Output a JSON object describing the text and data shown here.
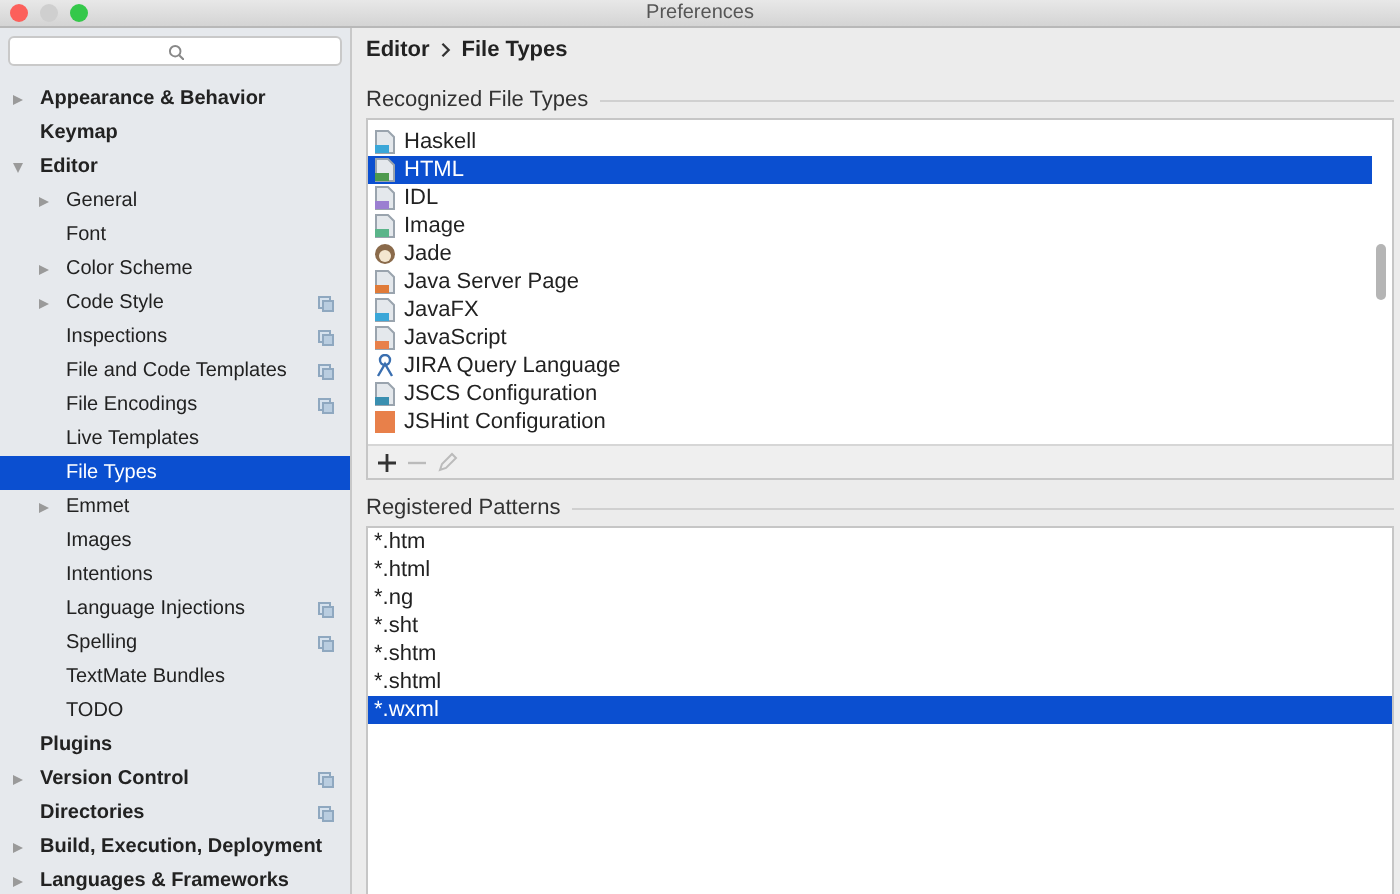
{
  "window": {
    "title": "Preferences"
  },
  "sidebar": {
    "items": [
      {
        "label": "Appearance & Behavior",
        "expandable": true,
        "expanded": false,
        "bold": true,
        "project_icon": false,
        "selected": false
      },
      {
        "label": "Keymap",
        "expandable": false,
        "bold": true,
        "project_icon": false,
        "selected": false
      },
      {
        "label": "Editor",
        "expandable": true,
        "expanded": true,
        "bold": true,
        "project_icon": false,
        "selected": false,
        "children": [
          {
            "label": "General",
            "expandable": true,
            "expanded": false,
            "project_icon": false,
            "selected": false
          },
          {
            "label": "Font",
            "expandable": false,
            "project_icon": false,
            "selected": false
          },
          {
            "label": "Color Scheme",
            "expandable": true,
            "expanded": false,
            "project_icon": false,
            "selected": false
          },
          {
            "label": "Code Style",
            "expandable": true,
            "expanded": false,
            "project_icon": true,
            "selected": false
          },
          {
            "label": "Inspections",
            "expandable": false,
            "project_icon": true,
            "selected": false
          },
          {
            "label": "File and Code Templates",
            "expandable": false,
            "project_icon": true,
            "selected": false
          },
          {
            "label": "File Encodings",
            "expandable": false,
            "project_icon": true,
            "selected": false
          },
          {
            "label": "Live Templates",
            "expandable": false,
            "project_icon": false,
            "selected": false
          },
          {
            "label": "File Types",
            "expandable": false,
            "project_icon": false,
            "selected": true
          },
          {
            "label": "Emmet",
            "expandable": true,
            "expanded": false,
            "project_icon": false,
            "selected": false
          },
          {
            "label": "Images",
            "expandable": false,
            "project_icon": false,
            "selected": false
          },
          {
            "label": "Intentions",
            "expandable": false,
            "project_icon": false,
            "selected": false
          },
          {
            "label": "Language Injections",
            "expandable": false,
            "project_icon": true,
            "selected": false
          },
          {
            "label": "Spelling",
            "expandable": false,
            "project_icon": true,
            "selected": false
          },
          {
            "label": "TextMate Bundles",
            "expandable": false,
            "project_icon": false,
            "selected": false
          },
          {
            "label": "TODO",
            "expandable": false,
            "project_icon": false,
            "selected": false
          }
        ]
      },
      {
        "label": "Plugins",
        "expandable": false,
        "bold": true,
        "project_icon": false,
        "selected": false
      },
      {
        "label": "Version Control",
        "expandable": true,
        "expanded": false,
        "bold": true,
        "project_icon": true,
        "selected": false
      },
      {
        "label": "Directories",
        "expandable": false,
        "bold": true,
        "project_icon": true,
        "selected": false
      },
      {
        "label": "Build, Execution, Deployment",
        "expandable": true,
        "expanded": false,
        "bold": true,
        "project_icon": false,
        "selected": false
      },
      {
        "label": "Languages & Frameworks",
        "expandable": true,
        "expanded": false,
        "bold": true,
        "project_icon": false,
        "selected": false
      }
    ]
  },
  "breadcrumb": [
    "Editor",
    "File Types"
  ],
  "file_types": {
    "title": "Recognized File Types",
    "items": [
      {
        "label": "Haskell",
        "kind": "file",
        "color": "#3ba7d8",
        "selected": false
      },
      {
        "label": "HTML",
        "kind": "file",
        "color": "#4e9a4e",
        "selected": true
      },
      {
        "label": "IDL",
        "kind": "file",
        "color": "#9b7fd1",
        "selected": false
      },
      {
        "label": "Image",
        "kind": "file",
        "color": "#5bb58a",
        "selected": false
      },
      {
        "label": "Jade",
        "kind": "face",
        "color": "#8a6a4a",
        "selected": false
      },
      {
        "label": "Java Server Page",
        "kind": "file",
        "color": "#e07b39",
        "selected": false
      },
      {
        "label": "JavaFX",
        "kind": "file",
        "color": "#3ba7d8",
        "selected": false
      },
      {
        "label": "JavaScript",
        "kind": "file",
        "color": "#e8804a",
        "selected": false
      },
      {
        "label": "JIRA Query Language",
        "kind": "figure",
        "color": "#3a6fb0",
        "selected": false
      },
      {
        "label": "JSCS Configuration",
        "kind": "file",
        "color": "#3a8fb0",
        "selected": false
      },
      {
        "label": "JSHint Configuration",
        "kind": "tile",
        "color": "#e8804a",
        "selected": false
      }
    ]
  },
  "patterns": {
    "title": "Registered Patterns",
    "items": [
      {
        "label": "*.htm",
        "selected": false
      },
      {
        "label": "*.html",
        "selected": false
      },
      {
        "label": "*.ng",
        "selected": false
      },
      {
        "label": "*.sht",
        "selected": false
      },
      {
        "label": "*.shtm",
        "selected": false
      },
      {
        "label": "*.shtml",
        "selected": false
      },
      {
        "label": "*.wxml",
        "selected": true
      }
    ]
  }
}
